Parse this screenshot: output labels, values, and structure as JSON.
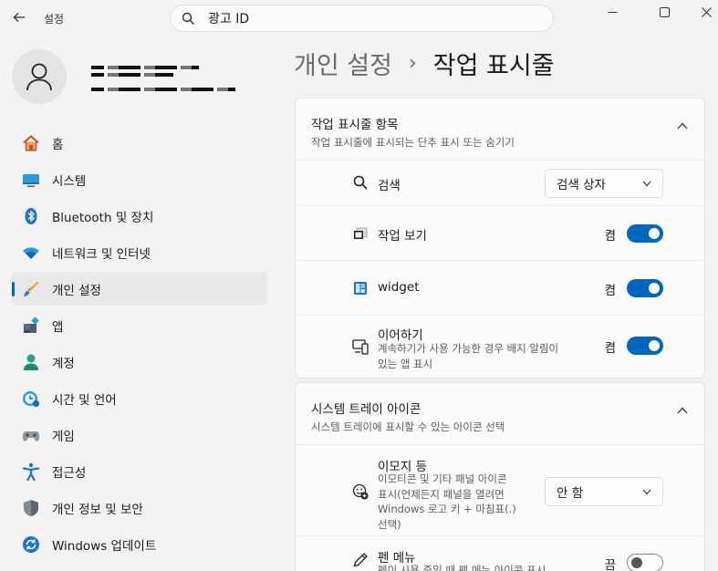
{
  "window": {
    "app_title": "설정",
    "back_label": "←",
    "minimize": "—",
    "maximize": "☐",
    "close": "✕"
  },
  "search": {
    "value": "광고 ID"
  },
  "sidebar": {
    "items": [
      {
        "label": "홈",
        "icon": "home-icon"
      },
      {
        "label": "시스템",
        "icon": "system-icon"
      },
      {
        "label": "Bluetooth 및 장치",
        "icon": "bluetooth-icon"
      },
      {
        "label": "네트워크 및 인터넷",
        "icon": "wifi-icon"
      },
      {
        "label": "개인 설정",
        "icon": "brush-icon",
        "active": true
      },
      {
        "label": "앱",
        "icon": "apps-icon"
      },
      {
        "label": "계정",
        "icon": "account-icon"
      },
      {
        "label": "시간 및 언어",
        "icon": "time-language-icon"
      },
      {
        "label": "게임",
        "icon": "gaming-icon"
      },
      {
        "label": "접근성",
        "icon": "accessibility-icon"
      },
      {
        "label": "개인 정보 및 보안",
        "icon": "shield-icon"
      },
      {
        "label": "Windows 업데이트",
        "icon": "update-icon"
      }
    ]
  },
  "heading": {
    "parent": "개인 설정",
    "separator": "›",
    "current": "작업 표시줄"
  },
  "taskbar_items": {
    "title": "작업 표시줄 항목",
    "subtitle": "작업 표시줄에 표시되는 단추 표시 또는 숨기기",
    "search": {
      "label": "검색",
      "value": "검색 상자"
    },
    "task_view": {
      "label": "작업 보기",
      "state": "켬",
      "on": true
    },
    "widget": {
      "label": "widget",
      "state": "켬",
      "on": true
    },
    "resume": {
      "label": "이어하기",
      "sub1": "계속하기가 사용 가능한 경우 배지 알림이",
      "sub2": "있는 앱 표시",
      "state": "켬",
      "on": true
    }
  },
  "tray_icons": {
    "title": "시스템 트레이 아이콘",
    "subtitle": "시스템 트레이에 표시할 수 있는 아이콘 선택",
    "emoji": {
      "label": "이모지 등",
      "sub1": "이모티콘 및 기타 패널 아이콘",
      "sub2": "표시(언제든지 패널을 열려면",
      "sub3": "Windows 로고 키 + 마침표(.)",
      "sub4": "선택)",
      "value": "안 함"
    },
    "pen": {
      "label": "펜 메뉴",
      "sub1": "펜이 사용 중일 때 펜 메뉴 아이콘 표시",
      "state": "끔",
      "on": false
    }
  },
  "colors": {
    "accent": "#0067c0",
    "background": "#f3f3f3",
    "card": "#fbfbfb"
  }
}
